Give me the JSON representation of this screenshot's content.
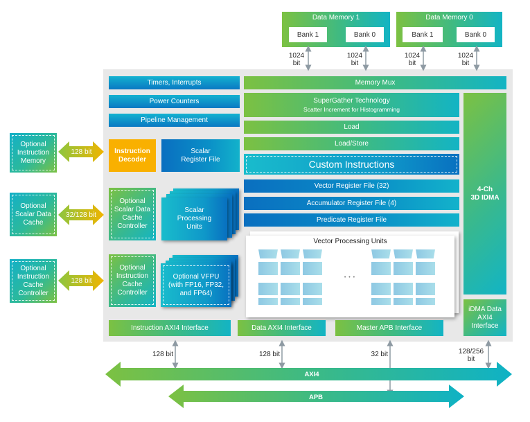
{
  "memories": [
    {
      "title": "Data Memory 1",
      "banks": [
        "Bank 1",
        "Bank 0"
      ]
    },
    {
      "title": "Data Memory 0",
      "banks": [
        "Bank 1",
        "Bank 0"
      ]
    }
  ],
  "memory_link_label": [
    "1024",
    "bit"
  ],
  "left_column": {
    "timers": "Timers, Interrupts",
    "power": "Power Counters",
    "pipeline": "Pipeline Management",
    "decoder": [
      "Instruction",
      "Decoder"
    ],
    "scalar_reg": [
      "Scalar",
      "Register File"
    ],
    "scalar_cache_ctrl": [
      "Optional",
      "Scalar Data",
      "Cache",
      "Controller"
    ],
    "scalar_units": [
      "Scalar",
      "Processing",
      "Units"
    ],
    "icache_ctrl": [
      "Optional",
      "Instruction",
      "Cache",
      "Controller"
    ],
    "vfpu": [
      "Optional VFPU",
      "(with FP16, FP32,",
      "and FP64)"
    ]
  },
  "middle_column": {
    "memory_mux": "Memory Mux",
    "supergather": "SuperGather Technology",
    "supergather_sub": "Scatter Increment for Histogramming",
    "load": "Load",
    "load_store": "Load/Store",
    "custom": "Custom Instructions",
    "vreg": "Vector Register File (32)",
    "acc": "Accumulator Register File (4)",
    "pred": "Predicate Register File",
    "vpu_title": "Vector Processing Units",
    "vpu_ellipsis": "• • •"
  },
  "right_column": {
    "idma": [
      "4-Ch",
      "3D IDMA"
    ],
    "idma_axi": [
      "iDMA Data",
      "AXI4",
      "Interface"
    ]
  },
  "interfaces": {
    "instr_axi": "Instruction AXI4 Interface",
    "data_axi": "Data AXI4 Interface",
    "apb": "Master APB Interface"
  },
  "external": {
    "imem": [
      "Optional",
      "Instruction",
      "Memory"
    ],
    "sdcache": [
      "Optional",
      "Scalar Data",
      "Cache"
    ],
    "icache": [
      "Optional",
      "Instruction",
      "Cache",
      "Controller"
    ]
  },
  "external_links": [
    "128 bit",
    "32/128 bit",
    "128 bit"
  ],
  "bus_links": [
    "128 bit",
    "128 bit",
    "32 bit",
    "128/256",
    "bit"
  ],
  "buses": {
    "axi": "AXI4",
    "apb": "APB"
  }
}
